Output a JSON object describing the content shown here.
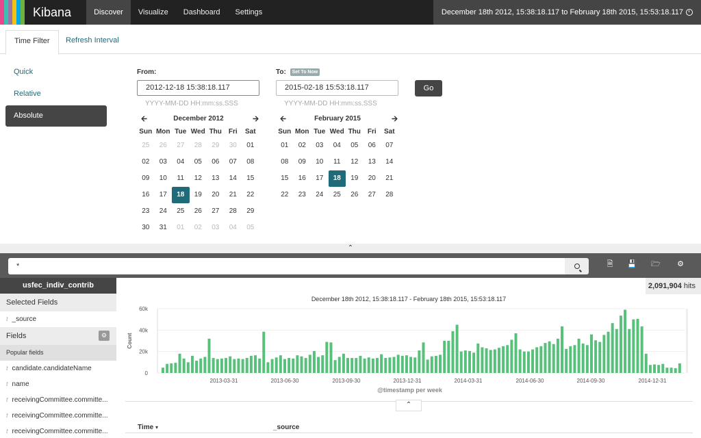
{
  "nav": {
    "brand": "Kibana",
    "stripe_colors": [
      "#e8488b",
      "#3ebeb0",
      "#9a76a8",
      "#f3c217",
      "#00a9e5",
      "#6db33f"
    ],
    "links": [
      "Discover",
      "Visualize",
      "Dashboard",
      "Settings"
    ],
    "active": "Discover",
    "time_range": "December 18th 2012, 15:38:18.117 to February 18th 2015, 15:53:18.117"
  },
  "time_filter": {
    "tabs": [
      "Time Filter",
      "Refresh Interval"
    ],
    "modes": [
      "Quick",
      "Relative",
      "Absolute"
    ],
    "active_mode": "Absolute",
    "from": {
      "label": "From:",
      "value": "2012-12-18 15:38:18.117",
      "format": "YYYY-MM-DD HH:mm:ss.SSS",
      "calendar": {
        "title": "December 2012",
        "dows": [
          "Sun",
          "Mon",
          "Tue",
          "Wed",
          "Thu",
          "Fri",
          "Sat"
        ],
        "cells": [
          "25",
          "26",
          "27",
          "28",
          "29",
          "30",
          "01",
          "02",
          "03",
          "04",
          "05",
          "06",
          "07",
          "08",
          "09",
          "10",
          "11",
          "12",
          "13",
          "14",
          "15",
          "16",
          "17",
          "18",
          "19",
          "20",
          "21",
          "22",
          "23",
          "24",
          "25",
          "26",
          "27",
          "28",
          "29",
          "30",
          "31",
          "01",
          "02",
          "03",
          "04",
          "05"
        ],
        "muted_before": 6,
        "muted_after_from": 37,
        "selected": 23
      }
    },
    "to": {
      "label": "To:",
      "set_to_now": "Set To Now",
      "value": "2015-02-18 15:53:18.117",
      "format": "YYYY-MM-DD HH:mm:ss.SSS",
      "calendar": {
        "title": "February 2015",
        "dows": [
          "Sun",
          "Mon",
          "Tue",
          "Wed",
          "Thu",
          "Fri",
          "Sat"
        ],
        "cells": [
          "01",
          "02",
          "03",
          "04",
          "05",
          "06",
          "07",
          "08",
          "09",
          "10",
          "11",
          "12",
          "13",
          "14",
          "15",
          "16",
          "17",
          "18",
          "19",
          "20",
          "21",
          "22",
          "23",
          "24",
          "25",
          "26",
          "27",
          "28"
        ],
        "muted_before": 0,
        "muted_after_from": 99,
        "selected": 17
      }
    },
    "go_label": "Go"
  },
  "search": {
    "query": "*"
  },
  "sidebar": {
    "index": "usfec_indiv_contrib",
    "selected_fields_label": "Selected Fields",
    "selected_fields": [
      "_source"
    ],
    "fields_label": "Fields",
    "popular_label": "Popular fields",
    "popular_fields": [
      "candidate.candidateName",
      "name",
      "receivingCommittee.committe...",
      "receivingCommittee.committe...",
      "receivingCommittee.committe..."
    ]
  },
  "hits": {
    "count": "2,091,904",
    "label": "hits"
  },
  "chart_data": {
    "type": "bar",
    "title": "December 18th 2012, 15:38:18.117 - February 18th 2015, 15:53:18.117",
    "xlabel": "@timestamp per week",
    "ylabel": "Count",
    "ylim": [
      0,
      60000
    ],
    "yticks": [
      "0",
      "20k",
      "40k",
      "60k"
    ],
    "xticks": [
      "2013-03-31",
      "2013-06-30",
      "2013-09-30",
      "2013-12-31",
      "2014-03-31",
      "2014-06-30",
      "2014-09-30",
      "2014-12-31"
    ],
    "bar_color": "#57c17b",
    "values": [
      5000,
      8500,
      9000,
      9500,
      18000,
      13500,
      10000,
      16000,
      11500,
      13500,
      15000,
      32000,
      14000,
      13000,
      13500,
      14000,
      15500,
      13000,
      13500,
      13000,
      14000,
      16000,
      16500,
      13500,
      38500,
      10000,
      13000,
      14500,
      16500,
      13000,
      14000,
      13500,
      16500,
      15500,
      14000,
      17000,
      20500,
      15000,
      16500,
      29000,
      28500,
      12000,
      15000,
      18000,
      14000,
      14000,
      14000,
      16000,
      13500,
      14500,
      13500,
      14000,
      17500,
      14000,
      14500,
      15000,
      17000,
      16000,
      16500,
      15000,
      14500,
      21000,
      28500,
      12500,
      15500,
      16000,
      17000,
      30000,
      30000,
      39000,
      45000,
      20000,
      21000,
      20500,
      19000,
      27500,
      24000,
      23000,
      21500,
      22000,
      23500,
      25000,
      26000,
      31000,
      37000,
      22000,
      20000,
      20000,
      22000,
      24000,
      25000,
      28000,
      29500,
      27000,
      32000,
      43500,
      22500,
      25000,
      26000,
      32000,
      27500,
      26000,
      36000,
      30500,
      29000,
      35500,
      38500,
      46500,
      41000,
      53500,
      59000,
      41000,
      50000,
      50500,
      43500,
      18000,
      7500,
      8000,
      7500,
      8500,
      5000,
      5000,
      4500,
      9000
    ]
  },
  "table": {
    "columns": [
      "Time",
      "_source"
    ]
  }
}
